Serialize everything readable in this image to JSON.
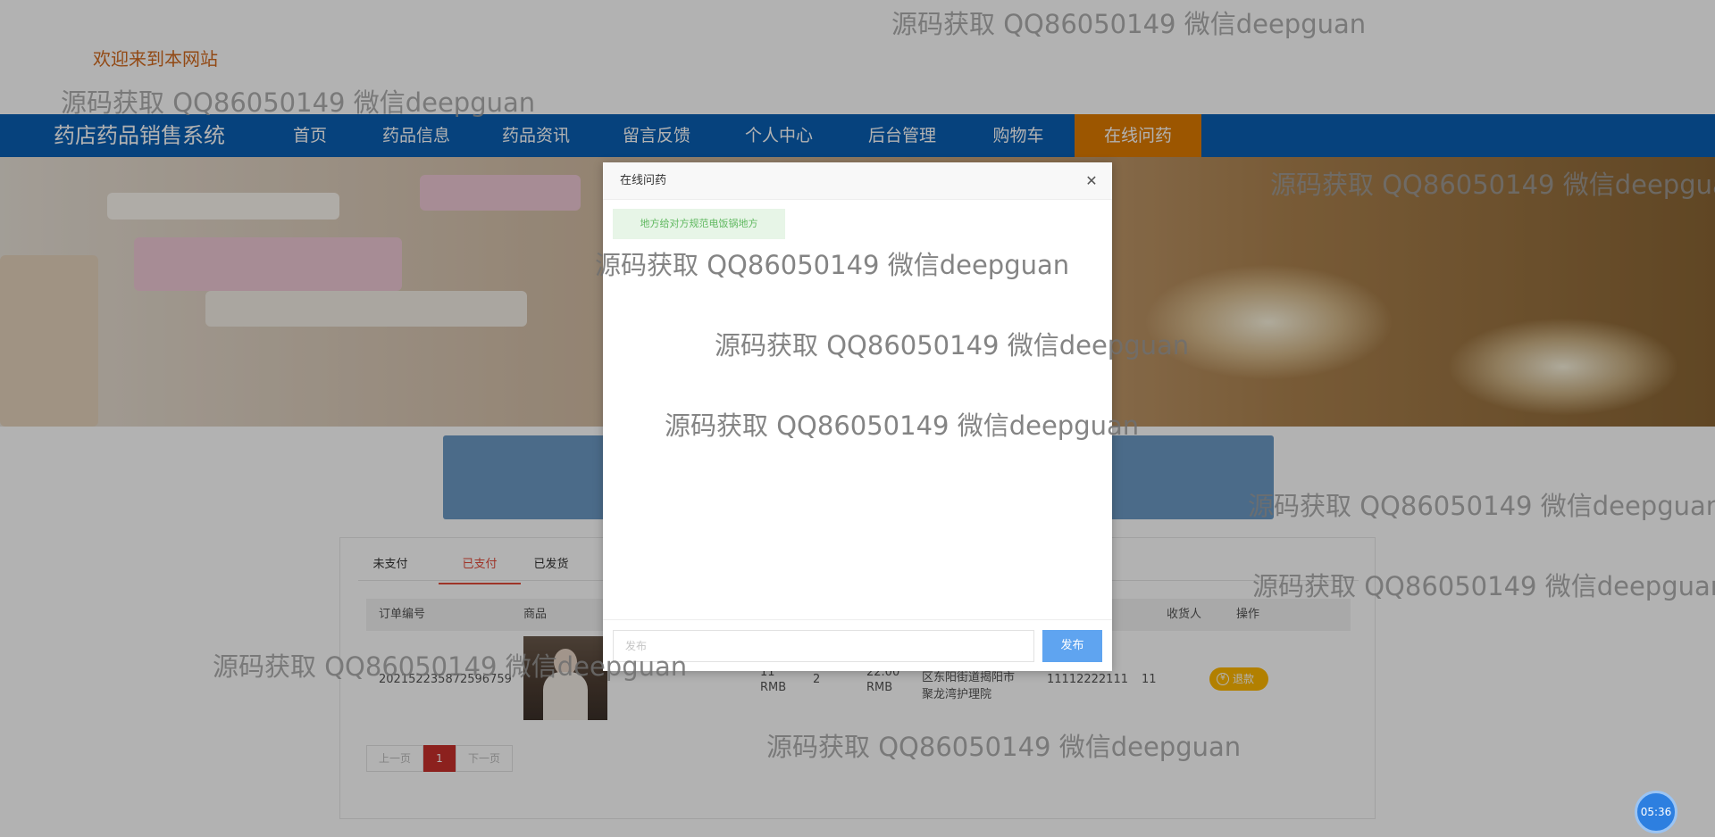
{
  "header": {
    "welcome": "欢迎来到本网站"
  },
  "nav": {
    "brand": "药店药品销售系统",
    "items": [
      {
        "label": "首页"
      },
      {
        "label": "药品信息"
      },
      {
        "label": "药品资讯"
      },
      {
        "label": "留言反馈"
      },
      {
        "label": "个人中心"
      },
      {
        "label": "后台管理"
      },
      {
        "label": "购物车"
      },
      {
        "label": "在线问药",
        "active": true
      }
    ],
    "colors": {
      "bar": "#0a5fb4",
      "active": "#e07b00"
    }
  },
  "orders": {
    "tabs": [
      {
        "label": "未支付"
      },
      {
        "label": "已支付",
        "active": true
      },
      {
        "label": "已发货"
      }
    ],
    "columns": {
      "order_no": "订单编号",
      "product": "商品",
      "recipient": "收货人",
      "action": "操作"
    },
    "row": {
      "order_no": "202152235872596759",
      "price_value": "11",
      "price_unit": "RMB",
      "quantity": "2",
      "total_value": "22.00",
      "total_unit": "RMB",
      "address_line1": "区东阳街道揭阳市",
      "address_line2": "聚龙湾护理院",
      "phone": "11112222111",
      "recipient": "11",
      "refund_label": "退款"
    },
    "pagination": {
      "prev": "上一页",
      "current": "1",
      "next": "下一页"
    }
  },
  "dialog": {
    "title": "在线问药",
    "close_icon": "✕",
    "message": "地方给对方规范电饭锅地方",
    "input_placeholder": "发布",
    "send_label": "发布"
  },
  "watermark_text": "源码获取 QQ86050149 微信deepguan",
  "timer": "05:36"
}
